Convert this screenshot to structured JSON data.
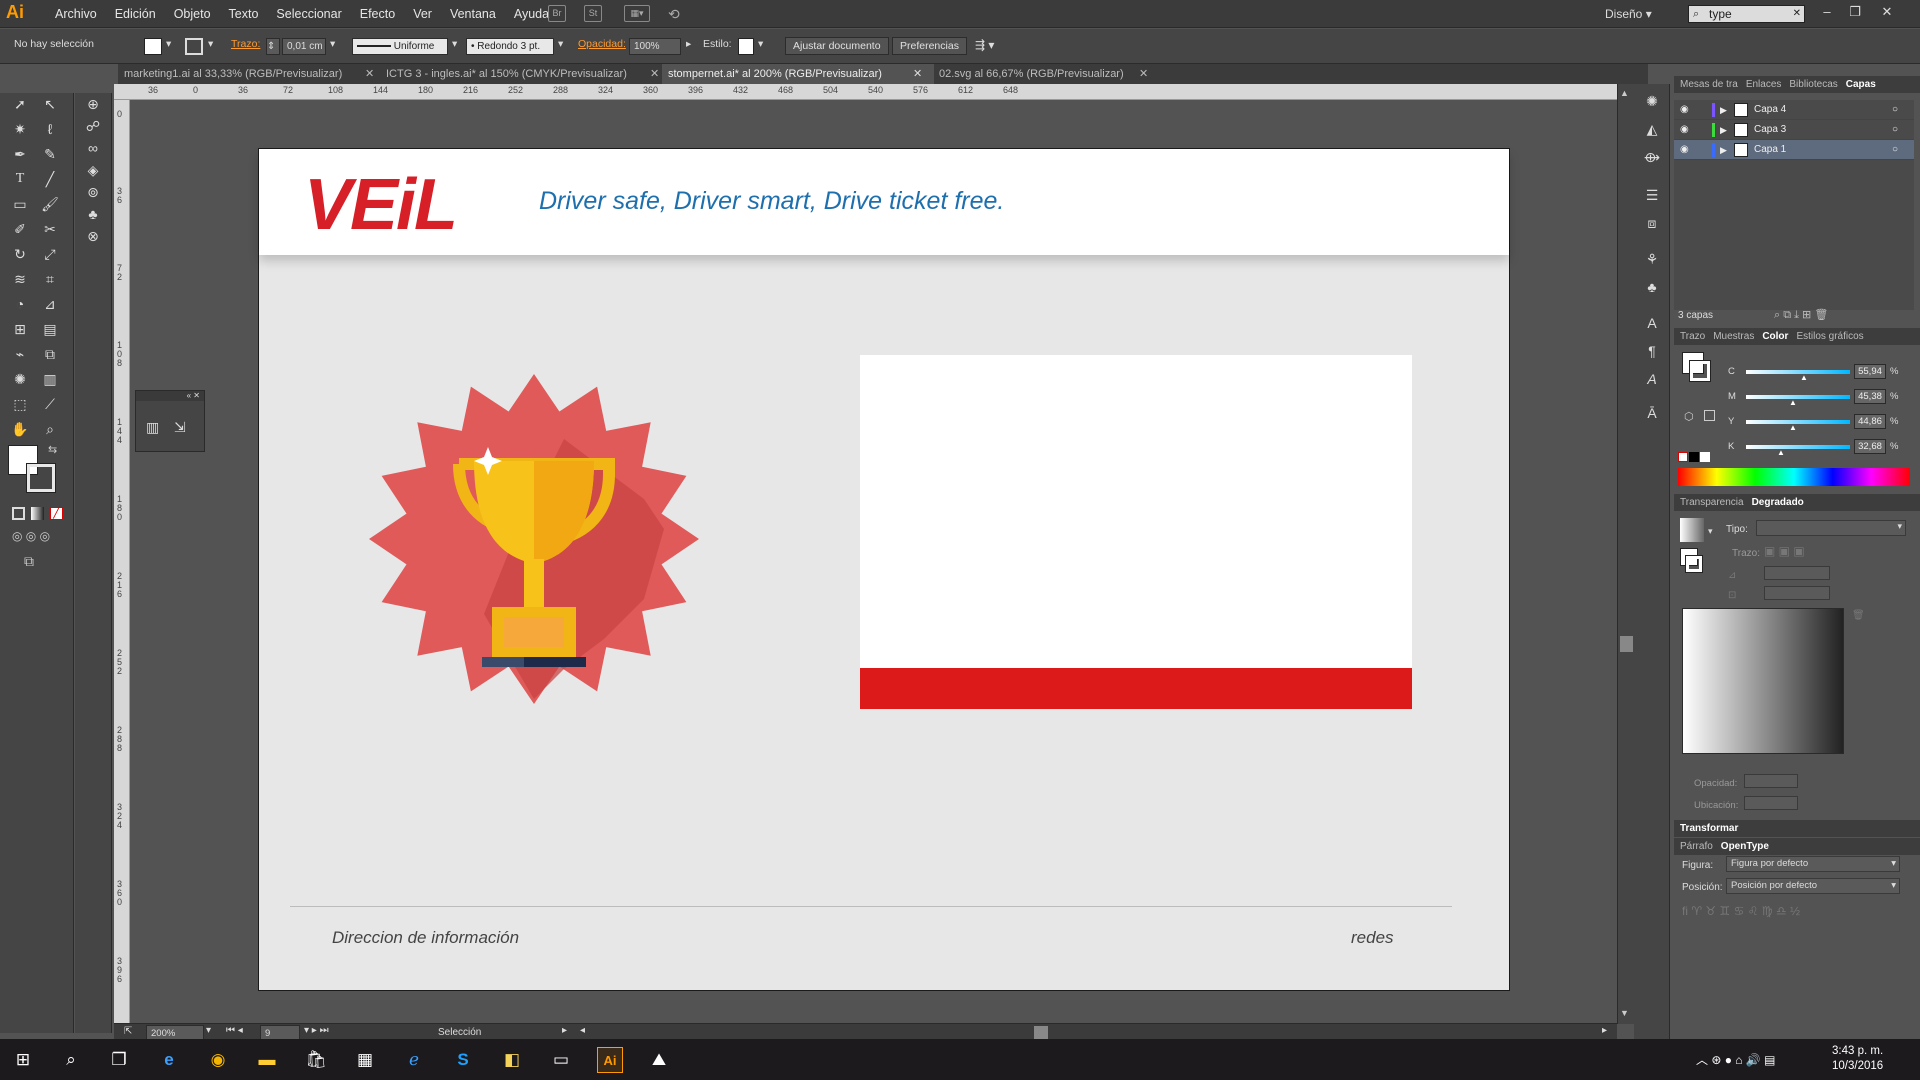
{
  "app": {
    "logo": "Ai",
    "menu": [
      "Archivo",
      "Edición",
      "Objeto",
      "Texto",
      "Seleccionar",
      "Efecto",
      "Ver",
      "Ventana",
      "Ayuda"
    ],
    "workspace": "Diseño",
    "search_value": "type"
  },
  "control": {
    "selection": "No hay selección",
    "stroke_label": "Trazo:",
    "stroke_value": "0,01 cm",
    "stroke_profile": "Uniforme",
    "brush": "Redondo 3 pt.",
    "opacity_label": "Opacidad:",
    "opacity_value": "100%",
    "style_label": "Estilo:",
    "fit_doc": "Ajustar documento",
    "prefs": "Preferencias"
  },
  "tabs": [
    {
      "label": "marketing1.ai al 33,33% (RGB/Previsualizar)",
      "active": false
    },
    {
      "label": "ICTG 3 - ingles.ai* al 150% (CMYK/Previsualizar)",
      "active": false
    },
    {
      "label": "stompernet.ai* al 200% (RGB/Previsualizar)",
      "active": true
    },
    {
      "label": "02.svg al 66,67% (RGB/Previsualizar)",
      "active": false
    }
  ],
  "ruler_h": [
    "36",
    "0",
    "36",
    "72",
    "108",
    "144",
    "180",
    "216",
    "252",
    "288",
    "324",
    "360",
    "396",
    "432",
    "468",
    "504",
    "540",
    "576",
    "612",
    "648"
  ],
  "ruler_v": [
    "0",
    "3 6",
    "7 2",
    "1 0 8",
    "1 4 4",
    "1 8 0",
    "2 1 6",
    "2 5 2",
    "2 8 8",
    "3 2 4",
    "3 6 0",
    "3 9 6"
  ],
  "artboard": {
    "logo": "VEiL",
    "tagline": "Driver safe, Driver smart, Drive ticket free.",
    "footer_left": "Direccion de información",
    "footer_right": "redes",
    "colors": {
      "red": "#dd1a1a",
      "badge": "#e05a5a",
      "badge_dark": "#c94444",
      "trophy": "#f7c31a",
      "blue": "#1e6fae"
    }
  },
  "status": {
    "zoom": "200%",
    "page": "9",
    "tool": "Selección"
  },
  "panels": {
    "top_tabs": [
      "Mesas de tra",
      "Enlaces",
      "Bibliotecas",
      "Capas"
    ],
    "layers": [
      {
        "name": "Capa 4",
        "color": "#7a54ff",
        "selected": false
      },
      {
        "name": "Capa 3",
        "color": "#3ddc3d",
        "selected": false
      },
      {
        "name": "Capa 1",
        "color": "#3a6bff",
        "selected": true
      }
    ],
    "layers_count": "3 capas",
    "color_tabs": [
      "Trazo",
      "Muestras",
      "Color",
      "Estilos gráficos"
    ],
    "cmyk": [
      {
        "label": "C",
        "value": "55,94",
        "level": 0.56
      },
      {
        "label": "M",
        "value": "45,38",
        "level": 0.45
      },
      {
        "label": "Y",
        "value": "44,86",
        "level": 0.45
      },
      {
        "label": "K",
        "value": "32,68",
        "level": 0.33
      }
    ],
    "percent": "%",
    "grad_tabs": [
      "Transparencia",
      "Degradado"
    ],
    "grad_type_label": "Tipo:",
    "grad_stroke_label": "Trazo:",
    "grad_opacity_label": "Opacidad:",
    "grad_location_label": "Ubicación:",
    "transform_tab": "Transformar",
    "para_tabs": [
      "Párrafo",
      "OpenType"
    ],
    "figure_label": "Figura:",
    "figure_value": "Figura por defecto",
    "position_label": "Posición:",
    "position_value": "Posición por defecto"
  },
  "taskbar": {
    "time": "3:43 p. m.",
    "date": "10/3/2016"
  }
}
